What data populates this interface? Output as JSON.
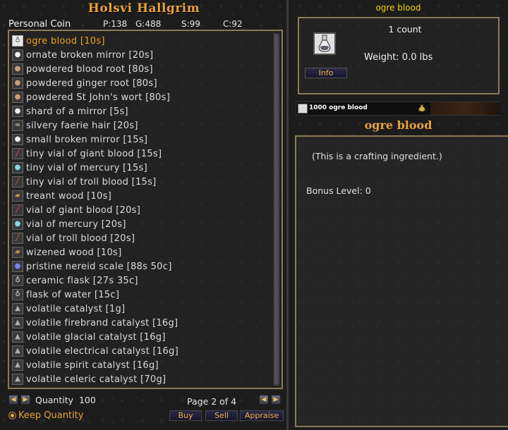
{
  "merchant": {
    "name": "Holsvi Hallgrim",
    "personal_coin_label": "Personal Coin",
    "platinum": "P:138",
    "gold": "G:488",
    "silver": "S:99",
    "copper": "C:92"
  },
  "items": [
    {
      "label": "ogre blood [10s]",
      "icon": "vial-icon",
      "selected": true
    },
    {
      "label": "ornate broken mirror [20s]",
      "icon": "mirror-icon"
    },
    {
      "label": "powdered blood root [80s]",
      "icon": "powder-icon"
    },
    {
      "label": "powdered ginger root [80s]",
      "icon": "powder-icon"
    },
    {
      "label": "powdered St John's wort [80s]",
      "icon": "powder-icon"
    },
    {
      "label": "shard of a mirror [5s]",
      "icon": "mirror-icon"
    },
    {
      "label": "silvery faerie hair [20s]",
      "icon": "hair-icon"
    },
    {
      "label": "small broken mirror [15s]",
      "icon": "mirror-icon"
    },
    {
      "label": "tiny vial of giant blood [15s]",
      "icon": "red-vial-icon"
    },
    {
      "label": "tiny vial of mercury [15s]",
      "icon": "mercury-icon"
    },
    {
      "label": "tiny vial of troll blood [15s]",
      "icon": "red-vial-icon"
    },
    {
      "label": "treant wood [10s]",
      "icon": "wood-icon"
    },
    {
      "label": "vial of giant blood [20s]",
      "icon": "red-vial-icon"
    },
    {
      "label": "vial of mercury [20s]",
      "icon": "mercury-icon"
    },
    {
      "label": "vial of troll blood [20s]",
      "icon": "red-vial-icon"
    },
    {
      "label": "wizened wood [10s]",
      "icon": "wood-icon"
    },
    {
      "label": "pristine nereid scale [88s 50c]",
      "icon": "scale-icon"
    },
    {
      "label": "ceramic flask [27s 35c]",
      "icon": "flask-icon"
    },
    {
      "label": "flask of water [15c]",
      "icon": "flask-icon"
    },
    {
      "label": "volatile catalyst [1g]",
      "icon": "catalyst-icon"
    },
    {
      "label": "volatile firebrand catalyst [16g]",
      "icon": "catalyst-icon"
    },
    {
      "label": "volatile glacial catalyst [16g]",
      "icon": "catalyst-icon"
    },
    {
      "label": "volatile electrical catalyst [16g]",
      "icon": "catalyst-icon"
    },
    {
      "label": "volatile spirit catalyst [16g]",
      "icon": "catalyst-icon"
    },
    {
      "label": "volatile celeric catalyst [70g]",
      "icon": "catalyst-icon"
    }
  ],
  "controls": {
    "quantity_label": "Quantity",
    "quantity_value": "100",
    "page_text": "Page 2 of 4",
    "keep_quantity": "Keep Quantity",
    "buy": "Buy",
    "sell": "Sell",
    "appraise": "Appraise"
  },
  "detail": {
    "title": "ogre blood",
    "count": "1 count",
    "weight": "Weight: 0.0 lbs",
    "info_button": "Info",
    "stack_text": "1000 ogre blood",
    "heading": "ogre blood",
    "description": "(This is a crafting ingredient.)",
    "bonus_level": "Bonus Level: 0"
  },
  "colors": {
    "accent": "#e8a23a",
    "selected_item": "#f0a020",
    "title_yellow": "#f0d000",
    "frame": "#8a7a58"
  }
}
